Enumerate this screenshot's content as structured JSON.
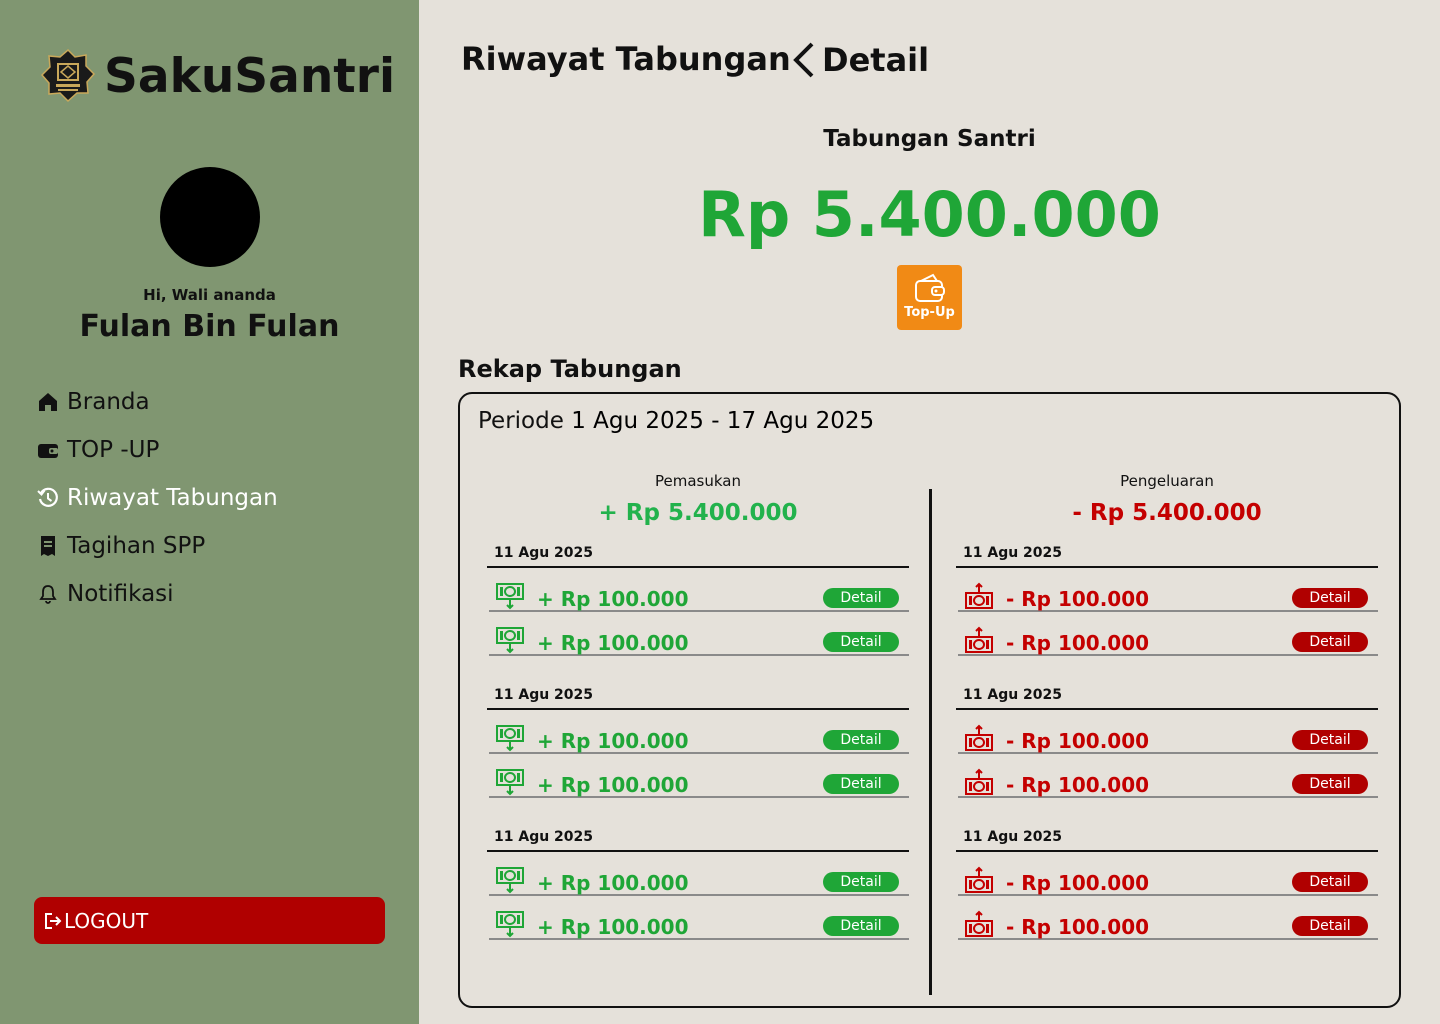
{
  "brand": {
    "name": "SakuSantri",
    "logo_icon": "mosque-emblem-icon"
  },
  "profile": {
    "greeting": "Hi, Wali ananda",
    "name": "Fulan Bin Fulan"
  },
  "nav": [
    {
      "label": "Branda",
      "icon": "home-icon",
      "active": false
    },
    {
      "label": "TOP -UP",
      "icon": "wallet-icon",
      "active": false
    },
    {
      "label": "Riwayat Tabungan",
      "icon": "history-icon",
      "active": true
    },
    {
      "label": "Tagihan SPP",
      "icon": "receipt-icon",
      "active": false
    },
    {
      "label": "Notifikasi",
      "icon": "bell-icon",
      "active": false
    }
  ],
  "logout_label": "LOGOUT",
  "header": {
    "title": "Riwayat Tabungan",
    "back_label": "Detail"
  },
  "savings": {
    "label": "Tabungan Santri",
    "amount": "Rp 5.400.000",
    "topup_label": "Top-Up"
  },
  "rekap": {
    "title": "Rekap Tabungan",
    "periode_label": "Periode",
    "periode_value": "1 Agu 2025 - 17 Agu 2025",
    "income": {
      "head": "Pemasukan",
      "total": "+ Rp 5.400.000",
      "groups": [
        {
          "date": "11 Agu 2025",
          "rows": [
            {
              "amount": "+ Rp 100.000",
              "action": "Detail"
            },
            {
              "amount": "+ Rp 100.000",
              "action": "Detail"
            }
          ]
        },
        {
          "date": "11 Agu 2025",
          "rows": [
            {
              "amount": "+ Rp 100.000",
              "action": "Detail"
            },
            {
              "amount": "+ Rp 100.000",
              "action": "Detail"
            }
          ]
        },
        {
          "date": "11 Agu 2025",
          "rows": [
            {
              "amount": "+ Rp 100.000",
              "action": "Detail"
            },
            {
              "amount": "+ Rp 100.000",
              "action": "Detail"
            }
          ]
        }
      ]
    },
    "expense": {
      "head": "Pengeluaran",
      "total": "- Rp 5.400.000",
      "groups": [
        {
          "date": "11 Agu 2025",
          "rows": [
            {
              "amount": "- Rp 100.000",
              "action": "Detail"
            },
            {
              "amount": "- Rp 100.000",
              "action": "Detail"
            }
          ]
        },
        {
          "date": "11 Agu 2025",
          "rows": [
            {
              "amount": "- Rp 100.000",
              "action": "Detail"
            },
            {
              "amount": "- Rp 100.000",
              "action": "Detail"
            }
          ]
        },
        {
          "date": "11 Agu 2025",
          "rows": [
            {
              "amount": "- Rp 100.000",
              "action": "Detail"
            },
            {
              "amount": "- Rp 100.000",
              "action": "Detail"
            }
          ]
        }
      ]
    }
  },
  "colors": {
    "sidebar": "#809671",
    "background": "#e5e1da",
    "income": "#1fa637",
    "expense": "#b00000",
    "topup": "#f18a15"
  }
}
